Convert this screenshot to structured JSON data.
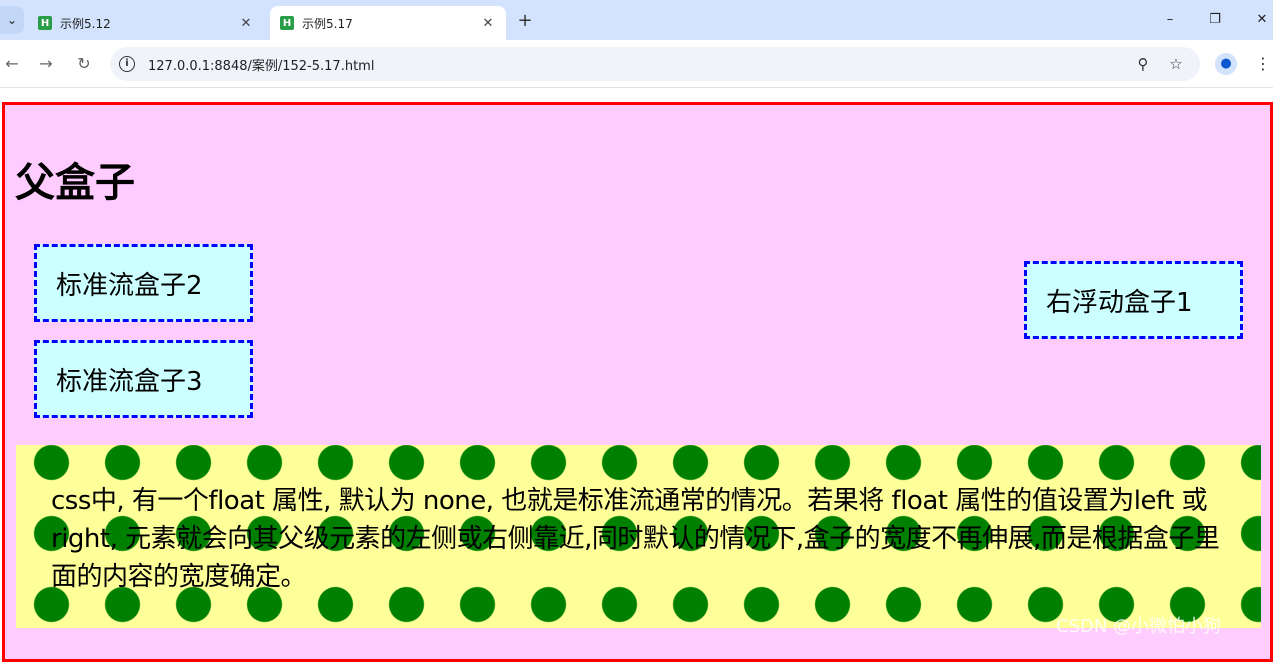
{
  "browser": {
    "tabs": [
      {
        "title": "示例5.12",
        "favicon": "H",
        "active": false
      },
      {
        "title": "示例5.17",
        "favicon": "H",
        "active": true
      }
    ],
    "url": "127.0.0.1:8848/案例/152-5.17.html",
    "icons": {
      "tab_search": "chevron-down-icon",
      "new_tab": "plus-icon",
      "back": "arrow-left-icon",
      "forward": "arrow-right-icon",
      "reload": "reload-icon",
      "site_info": "info-icon",
      "zoom": "zoom-icon",
      "bookmark": "star-icon",
      "profile": "profile-icon",
      "menu": "menu-dots-icon"
    }
  },
  "page": {
    "parent_title": "父盒子",
    "boxes": {
      "standard2": "标准流盒子2",
      "standard3": "标准流盒子3",
      "float_right1": "右浮动盒子1"
    },
    "description": "css中, 有一个float 属性, 默认为 none, 也就是标准流通常的情况。若果将 float 属性的值设置为left 或 right, 元素就会向其父级元素的左侧或右侧靠近,同时默认的情况下,盒子的宽度不再伸展,而是根据盒子里面的内容的宽度确定。",
    "watermark": "CSDN @小微怕小狗"
  },
  "colors": {
    "parent_border": "#ff0000",
    "parent_bg": "#ffccff",
    "box_border": "#0000ff",
    "box_bg": "#ccffff",
    "desc_bg": "#ffff99",
    "dot": "#008000"
  }
}
